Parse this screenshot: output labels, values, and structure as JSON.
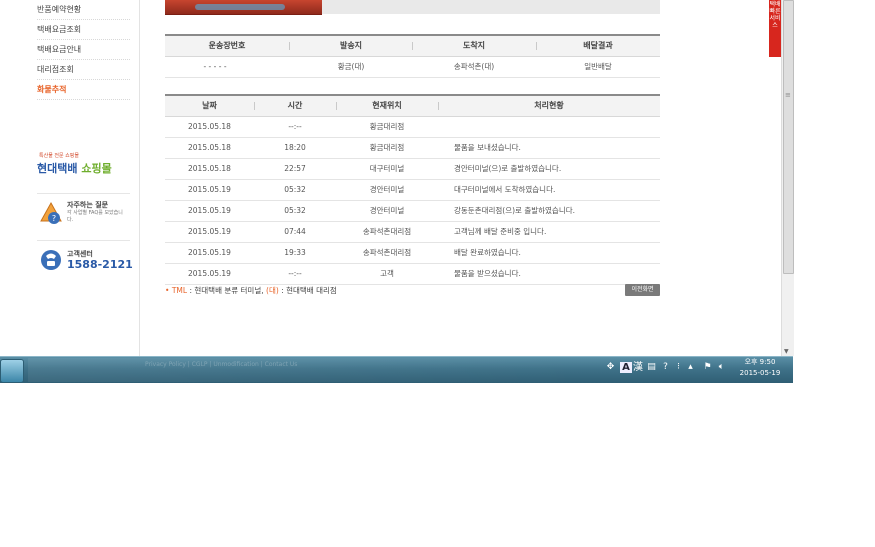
{
  "sidebar": {
    "items": [
      {
        "label": "반품예약현황",
        "active": false
      },
      {
        "label": "택배요금조회",
        "active": false
      },
      {
        "label": "택배요금안내",
        "active": false
      },
      {
        "label": "대리점조회",
        "active": false
      },
      {
        "label": "화물추적",
        "active": true
      }
    ],
    "promo": {
      "small": "특산물 전문 쇼핑몰",
      "brand": "현대택배",
      "shop": "쇼핑몰"
    },
    "faq": {
      "title": "자주하는 질문",
      "desc": "각 사업별 FAQ를 모았습니다."
    },
    "support": {
      "title": "고객센터",
      "phone": "1588-2121"
    }
  },
  "summary_table": {
    "headers": [
      "운송장번호",
      "발송지",
      "도착지",
      "배달결과"
    ],
    "row": [
      "- - - - -",
      "황금(대)",
      "송파석촌(대)",
      "일반배달"
    ]
  },
  "tracking_table": {
    "headers": [
      "날짜",
      "시간",
      "현재위치",
      "처리현황"
    ],
    "rows": [
      [
        "2015.05.18",
        "--:--",
        "황금대리점",
        ""
      ],
      [
        "2015.05.18",
        "18:20",
        "황금대리점",
        "물품을 보내셨습니다."
      ],
      [
        "2015.05.18",
        "22:57",
        "대구터미널",
        "경안터미널(으)로 출발하였습니다."
      ],
      [
        "2015.05.19",
        "05:32",
        "경안터미널",
        "대구터미널에서 도착하였습니다."
      ],
      [
        "2015.05.19",
        "05:32",
        "경안터미널",
        "강동둔촌대리점(으)로 출발하였습니다."
      ],
      [
        "2015.05.19",
        "07:44",
        "송파석촌대리점",
        "고객님께 배달 준비중 입니다."
      ],
      [
        "2015.05.19",
        "19:33",
        "송파석촌대리점",
        "배달 완료하였습니다."
      ],
      [
        "2015.05.19",
        "--:--",
        "고객",
        "물품을 받으셨습니다."
      ]
    ]
  },
  "legend": {
    "bullet": "•",
    "tml": "TML",
    "tml_desc": ": 현대택배 분류 터미널,",
    "dae": "(대)",
    "dae_desc": ": 현대택배 대리점"
  },
  "prev_button": "이전화면",
  "side_banner": "택배 빠른서비스",
  "taskbar": {
    "ghost_text": "Privacy Policy  |  CGLP  |  Unmodification  |  Contact Us",
    "ime_a": "A",
    "ime_han": "漢",
    "clock_time": "오후 9:50",
    "clock_date": "2015-05-19"
  }
}
